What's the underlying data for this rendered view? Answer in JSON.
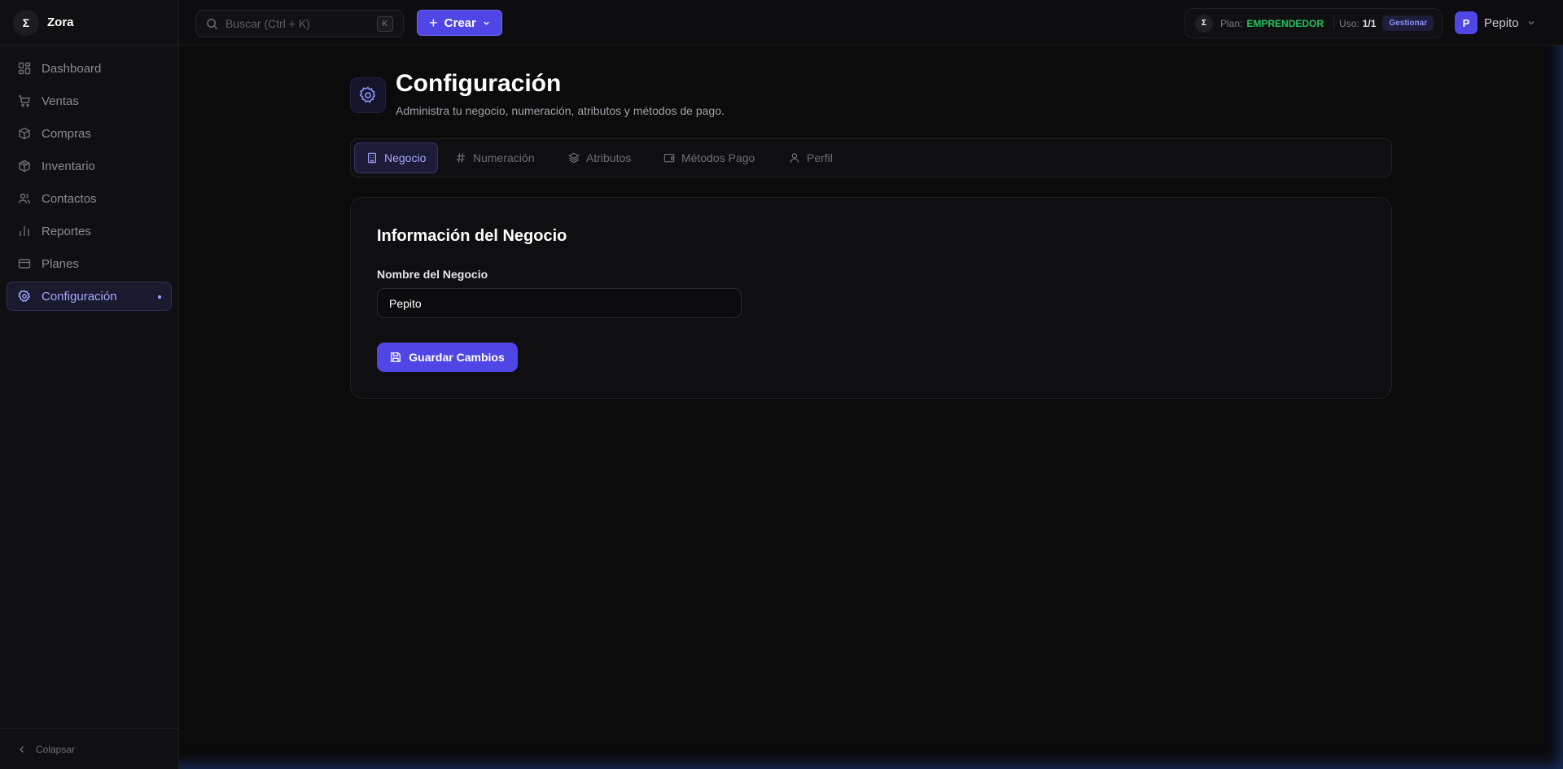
{
  "app": {
    "name": "Zora",
    "logo_glyph": "Σ"
  },
  "sidebar": {
    "items": [
      {
        "label": "Dashboard",
        "icon": "dashboard-icon"
      },
      {
        "label": "Ventas",
        "icon": "cart-icon"
      },
      {
        "label": "Compras",
        "icon": "box-icon"
      },
      {
        "label": "Inventario",
        "icon": "package-icon"
      },
      {
        "label": "Contactos",
        "icon": "users-icon"
      },
      {
        "label": "Reportes",
        "icon": "bar-chart-icon"
      },
      {
        "label": "Planes",
        "icon": "credit-card-icon"
      },
      {
        "label": "Configuración",
        "icon": "gear-icon",
        "active": true
      }
    ],
    "collapse_label": "Colapsar"
  },
  "topbar": {
    "search_placeholder": "Buscar (Ctrl + K)",
    "search_kbd": "K",
    "create_label": "Crear",
    "plan": {
      "label": "Plan:",
      "name": "EMPRENDEDOR",
      "usage_label": "Uso:",
      "usage_value": "1/1",
      "manage_label": "Gestionar"
    },
    "user": {
      "initial": "P",
      "name": "Pepito"
    }
  },
  "page": {
    "title": "Configuración",
    "subtitle": "Administra tu negocio, numeración, atributos y métodos de pago.",
    "tabs": [
      {
        "label": "Negocio",
        "icon": "building-icon",
        "active": true
      },
      {
        "label": "Numeración",
        "icon": "hash-icon"
      },
      {
        "label": "Atributos",
        "icon": "layers-icon"
      },
      {
        "label": "Métodos Pago",
        "icon": "wallet-icon"
      },
      {
        "label": "Perfil",
        "icon": "user-icon"
      }
    ],
    "card": {
      "title": "Información del Negocio",
      "field_label": "Nombre del Negocio",
      "field_value": "Pepito",
      "save_label": "Guardar Cambios"
    }
  },
  "colors": {
    "accent": "#5046e5",
    "accent_text": "#a5a8ff",
    "plan_green": "#22c55e",
    "background": "#0b0b0c"
  }
}
